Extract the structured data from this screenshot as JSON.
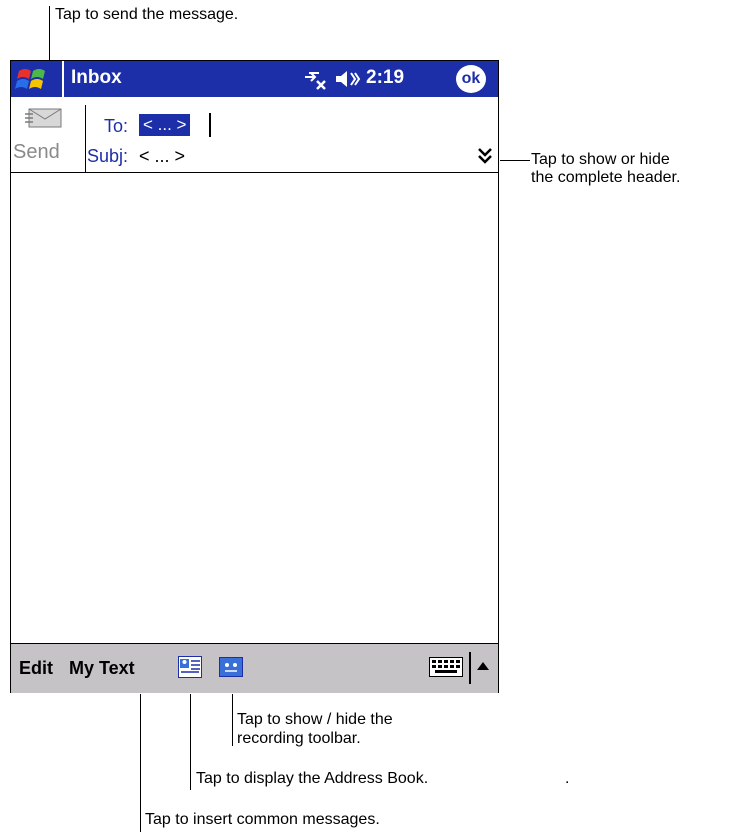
{
  "titlebar": {
    "title": "Inbox",
    "time": "2:19",
    "ok": "ok",
    "icons": [
      "windows-start-icon",
      "connectivity-icon",
      "speaker-icon"
    ]
  },
  "header": {
    "send_label": "Send",
    "to_label": "To:",
    "to_value": "< ... >",
    "subj_label": "Subj:",
    "subj_value": "< ... >"
  },
  "menubar": {
    "edit": "Edit",
    "my_text": "My Text",
    "icons": [
      "address-book-icon",
      "recording-toolbar-icon",
      "keyboard-icon",
      "sip-arrow-icon"
    ]
  },
  "callouts": {
    "send": "Tap to send the message.",
    "header_line1": "Tap to show or hide",
    "header_line2": "the complete header.",
    "recording_line1": "Tap to show / hide the",
    "recording_line2": "recording toolbar.",
    "address_book": "Tap to display the Address Book.",
    "dot": ".",
    "mytext": "Tap to insert common messages."
  },
  "colors": {
    "titlebar": "#1c2ea8",
    "menubar": "#c6c3c6",
    "field_highlight": "#1c2ea8"
  }
}
